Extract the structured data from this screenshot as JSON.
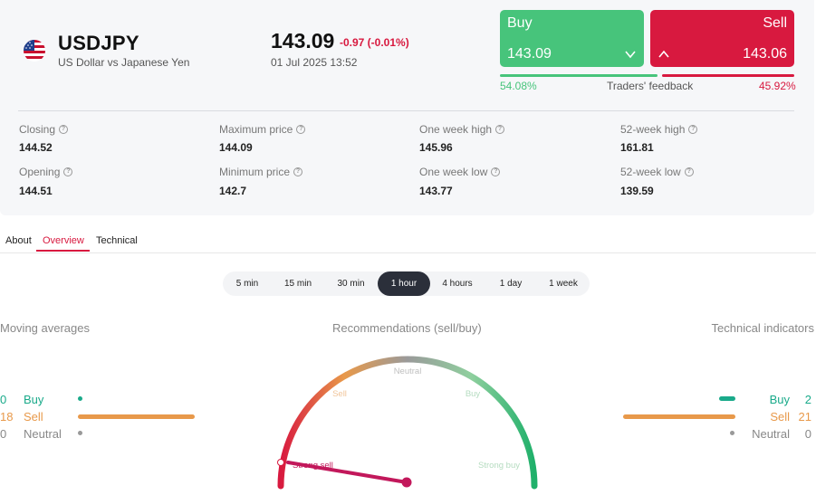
{
  "instrument": {
    "symbol": "USDJPY",
    "description": "US Dollar vs Japanese Yen",
    "flag_icon": "us-flag-icon"
  },
  "quote": {
    "price": "143.09",
    "change": "-0.97 (-0.01%)",
    "timestamp": "01 Jul 2025 13:52"
  },
  "trade": {
    "buy_label": "Buy",
    "buy_price": "143.09",
    "sell_label": "Sell",
    "sell_price": "143.06",
    "buy_color": "#47c47b",
    "sell_color": "#d8193f"
  },
  "feedback": {
    "buy_pct": "54.08%",
    "label": "Traders' feedback",
    "sell_pct": "45.92%",
    "buy_fraction": 0.5408
  },
  "stats": [
    {
      "label": "Closing",
      "value": "144.52"
    },
    {
      "label": "Maximum price",
      "value": "144.09"
    },
    {
      "label": "One week high",
      "value": "145.96"
    },
    {
      "label": "52-week high",
      "value": "161.81"
    },
    {
      "label": "Opening",
      "value": "144.51"
    },
    {
      "label": "Minimum price",
      "value": "142.7"
    },
    {
      "label": "One week low",
      "value": "143.77"
    },
    {
      "label": "52-week low",
      "value": "139.59"
    }
  ],
  "tabs": [
    {
      "label": "About"
    },
    {
      "label": "Overview",
      "active": true
    },
    {
      "label": "Technical"
    }
  ],
  "timeframes": [
    {
      "label": "5 min"
    },
    {
      "label": "15 min"
    },
    {
      "label": "30 min"
    },
    {
      "label": "1 hour",
      "active": true
    },
    {
      "label": "4 hours"
    },
    {
      "label": "1 day"
    },
    {
      "label": "1 week"
    }
  ],
  "moving_averages": {
    "title": "Moving averages",
    "rows": [
      {
        "count": "0",
        "label": "Buy",
        "color": "#1aaa8a"
      },
      {
        "count": "18",
        "label": "Sell",
        "color": "#e8994a"
      },
      {
        "count": "0",
        "label": "Neutral",
        "color": "#999999"
      }
    ]
  },
  "recommendations": {
    "title": "Recommendations (sell/buy)",
    "labels": {
      "neutral": "Neutral",
      "sell": "Sell",
      "buy": "Buy",
      "strong_sell": "Strong sell",
      "strong_buy": "Strong buy"
    },
    "needle_color": "#c2185b"
  },
  "technical_indicators": {
    "title": "Technical indicators",
    "rows": [
      {
        "count": "2",
        "label": "Buy",
        "color": "#1aaa8a"
      },
      {
        "count": "21",
        "label": "Sell",
        "color": "#e8994a"
      },
      {
        "count": "0",
        "label": "Neutral",
        "color": "#999999"
      }
    ]
  }
}
